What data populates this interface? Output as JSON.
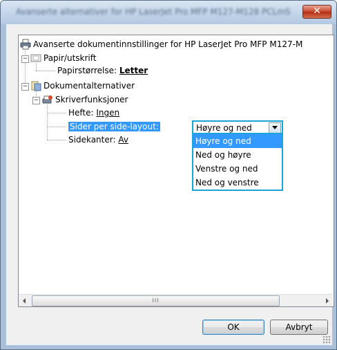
{
  "window": {
    "title": "Avanserte alternativer for HP LaserJet Pro MFP M127-M128 PCLmS",
    "close_symbol": "✕"
  },
  "tree": {
    "root_label": "Avanserte dokumentinnstillinger for HP LaserJet Pro MFP M127-M",
    "paper": {
      "label": "Papir/utskrift",
      "size_label": "Papirstørrelse: ",
      "size_value": "Letter"
    },
    "docopts": {
      "label": "Dokumentalternativer",
      "printer_features": {
        "label": "Skriverfunksjoner",
        "booklet_label": "Hefte: ",
        "booklet_value": "Ingen",
        "pages_per_side_label": "Sider per side-layout:",
        "pages_per_side_value": "Høyre og ned",
        "borders_label": "Sidekanter: ",
        "borders_value": "Av"
      }
    }
  },
  "dropdown": {
    "options": [
      "Høyre og ned",
      "Ned og høyre",
      "Venstre og ned",
      "Ned og venstre"
    ],
    "selected_index": 0
  },
  "scrollbar": {
    "thumb_grip": "III"
  },
  "buttons": {
    "ok": "OK",
    "cancel": "Avbryt"
  },
  "colors": {
    "selection": "#3399ff",
    "focus_border": "#1aa5d6"
  }
}
